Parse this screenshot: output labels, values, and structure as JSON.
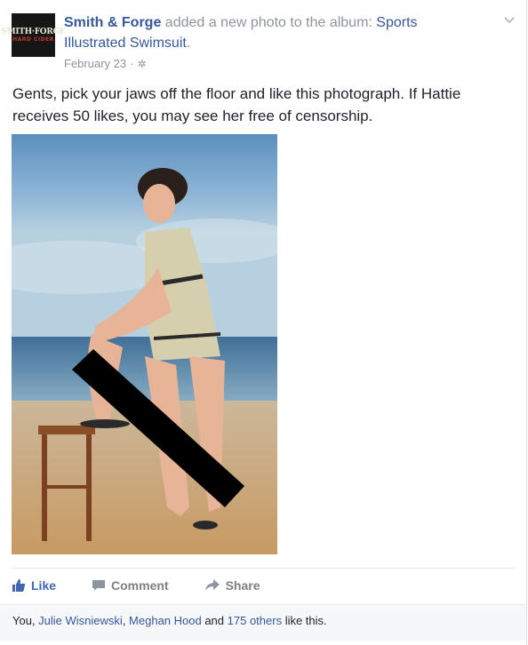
{
  "post": {
    "page_name": "Smith & Forge",
    "action_text": " added a new photo to the album: ",
    "album_name": "Sports Illustrated Swimsuit",
    "album_suffix": ".",
    "date": "February 23",
    "date_sep": "·",
    "avatar_line1": "SMITH·FORGE",
    "avatar_line2": "HARD CIDER",
    "text": "Gents, pick your jaws off the floor and like this photograph. If Hattie receives 50 likes, you may see her free of censorship."
  },
  "actions": {
    "like": "Like",
    "comment": "Comment",
    "share": "Share"
  },
  "likes": {
    "prefix": "You, ",
    "name1": "Julie Wisniewski",
    "sep1": ", ",
    "name2": "Meghan Hood",
    "and": " and ",
    "others": "175 others",
    "suffix": " like this."
  },
  "colors": {
    "link": "#365899",
    "like_blue": "#4267b2",
    "muted": "#90949c"
  }
}
